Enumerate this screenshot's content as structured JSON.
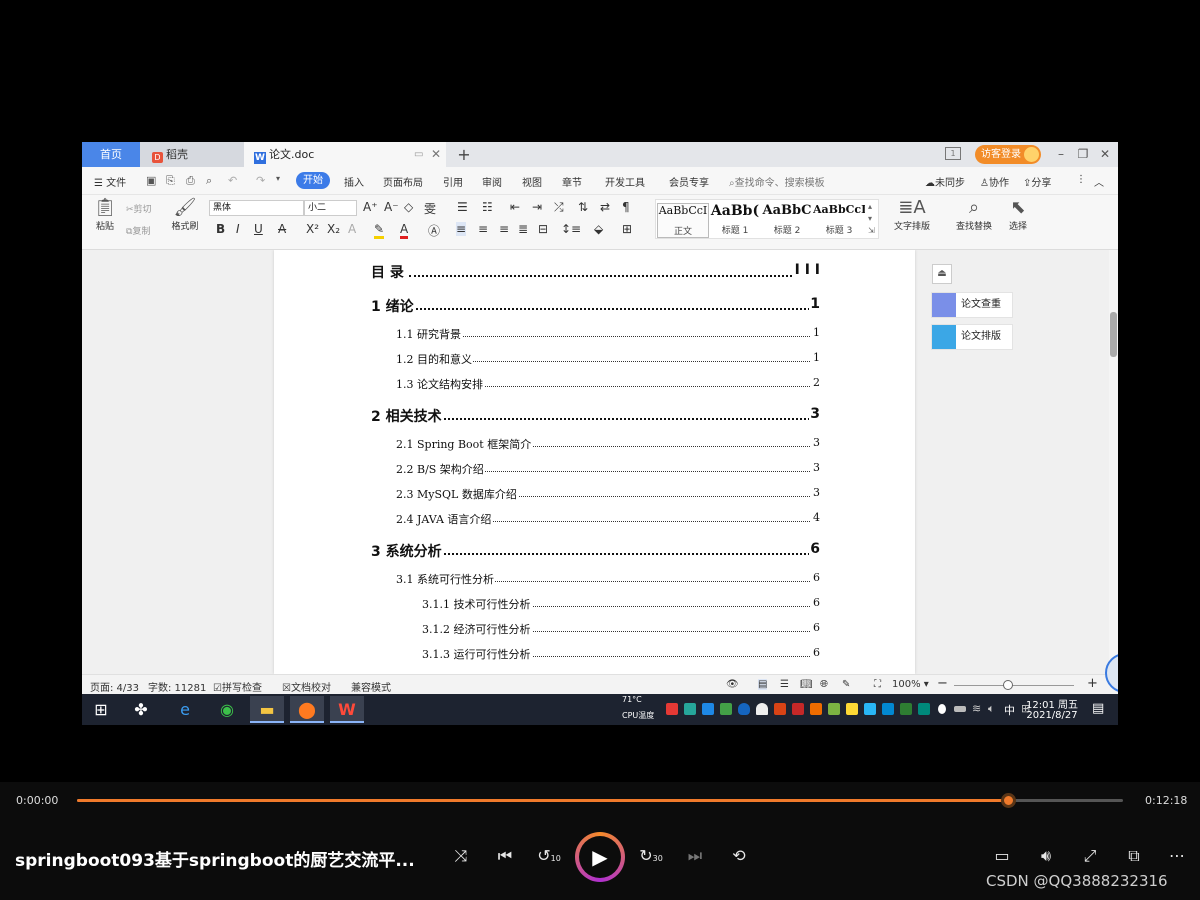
{
  "wps": {
    "tabs": {
      "home": "首页",
      "docer": "稻壳",
      "doc": "论文.doc",
      "docer_badge": "D",
      "doc_badge": "W",
      "add": "+"
    },
    "login_label": "访客登录",
    "page_count_badge": "1",
    "menu": {
      "file": "文件",
      "active": "开始",
      "items": [
        "插入",
        "页面布局",
        "引用",
        "审阅",
        "视图",
        "章节",
        "开发工具",
        "会员专享"
      ],
      "search_placeholder": "查找命令、搜索模板",
      "sync": "未同步",
      "collab": "协作",
      "share": "分享"
    },
    "ribbon": {
      "paste": "粘贴",
      "cut": "剪切",
      "copy": "复制",
      "format_painter": "格式刷",
      "font_name": "黑体",
      "font_size": "小二",
      "styles": [
        {
          "sample": "AaBbCcI",
          "label": "正文"
        },
        {
          "sample": "AaBb(",
          "label": "标题 1"
        },
        {
          "sample": "AaBbC",
          "label": "标题 2"
        },
        {
          "sample": "AaBbCcI",
          "label": "标题 3"
        }
      ],
      "text_layout": "文字排版",
      "find_replace": "查找替换",
      "select": "选择"
    },
    "toc": {
      "title": "目  录",
      "title_page": "I I I",
      "entries": [
        {
          "text": "1  绪论",
          "page": "1",
          "level": 0
        },
        {
          "text": "1.1  研究背景",
          "page": "1",
          "level": 1
        },
        {
          "text": "1.2 目的和意义",
          "page": "1",
          "level": 1
        },
        {
          "text": "1.3  论文结构安排",
          "page": "2",
          "level": 1
        },
        {
          "text": "2  相关技术",
          "page": "3",
          "level": 0
        },
        {
          "text": "2.1 Spring Boot 框架简介",
          "page": "3",
          "level": 1
        },
        {
          "text": "2.2 B/S 架构介绍",
          "page": "3",
          "level": 1
        },
        {
          "text": "2.3 MySQL 数据库介绍",
          "page": "3",
          "level": 1
        },
        {
          "text": "2.4 JAVA 语言介绍",
          "page": "4",
          "level": 1
        },
        {
          "text": "3  系统分析",
          "page": "6",
          "level": 0
        },
        {
          "text": "3.1 系统可行性分析",
          "page": "6",
          "level": 1
        },
        {
          "text": "3.1.1  技术可行性分析",
          "page": "6",
          "level": 2
        },
        {
          "text": "3.1.2  经济可行性分析",
          "page": "6",
          "level": 2
        },
        {
          "text": "3.1.3  运行可行性分析",
          "page": "6",
          "level": 2
        }
      ]
    },
    "side_panel": {
      "check": "论文查重",
      "layout": "论文排版"
    },
    "status": {
      "page": "页面: 4/33",
      "words": "字数: 11281",
      "spell": "拼写检查",
      "proof": "文档校对",
      "compat": "兼容模式",
      "zoom": "100%"
    },
    "taskbar": {
      "cpu_temp": "71°C",
      "cpu_label": "CPU温度",
      "ime": "中",
      "time": "12:01 周五",
      "date": "2021/8/27"
    }
  },
  "player": {
    "current_time": "0:00:00",
    "duration": "0:12:18",
    "progress": 0.89,
    "title": "springboot093基于springboot的厨艺交流平...",
    "skip_back": "10",
    "skip_forward": "30"
  },
  "watermark": "CSDN @QQ3888232316",
  "colors": {
    "accent_blue": "#3c7be8",
    "progress_orange": "#f07a2b",
    "login_orange": "#f28c28"
  }
}
